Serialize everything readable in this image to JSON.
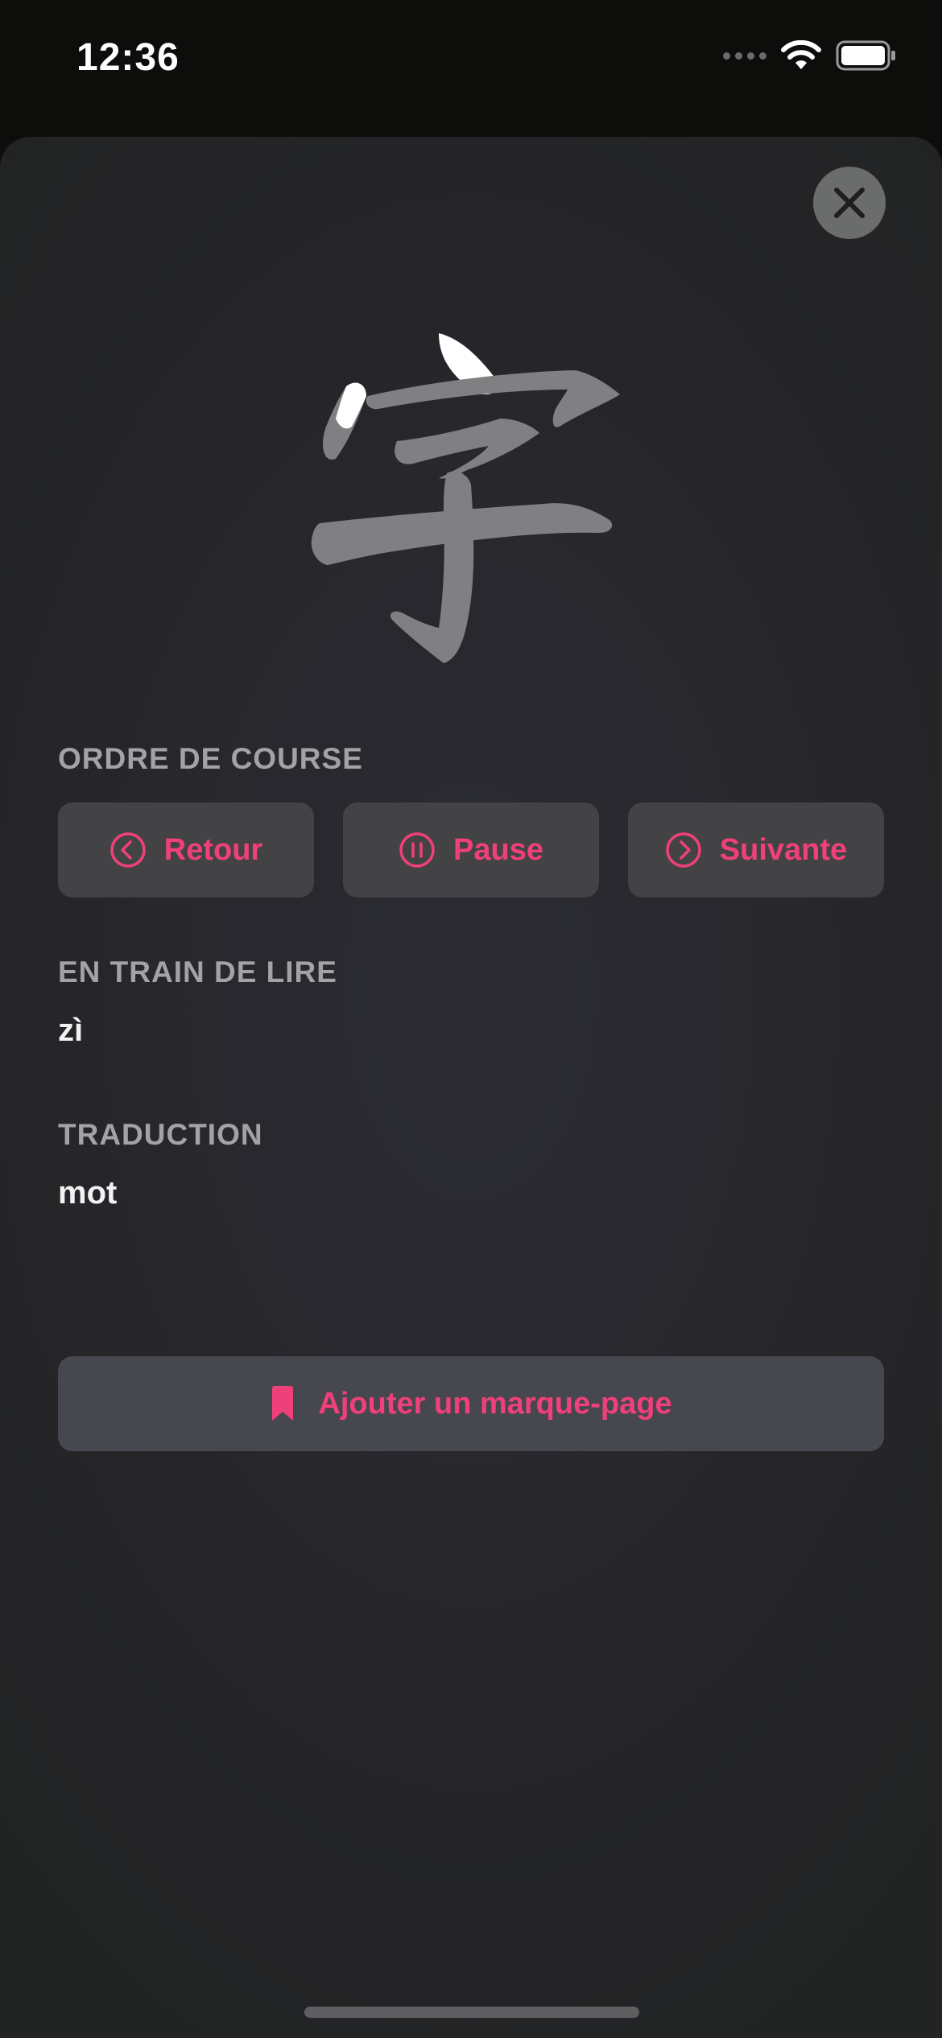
{
  "status_bar": {
    "time": "12:36",
    "icons": [
      "signal-dots-icon",
      "wifi-icon",
      "battery-icon"
    ]
  },
  "character": {
    "glyph": "字",
    "strokes_total": 6,
    "strokes_completed": 1
  },
  "stroke_order": {
    "label": "ORDRE DE COURSE",
    "buttons": [
      {
        "label": "Retour",
        "icon": "chevron-left-circle-icon"
      },
      {
        "label": "Pause",
        "icon": "pause-circle-icon"
      },
      {
        "label": "Suivante",
        "icon": "chevron-right-circle-icon"
      }
    ]
  },
  "reading": {
    "label": "EN TRAIN DE LIRE",
    "value": "zì"
  },
  "translation": {
    "label": "TRADUCTION",
    "value": "mot"
  },
  "bookmark": {
    "label": "Ajouter un marque-page",
    "icon": "bookmark-icon"
  },
  "colors": {
    "accent": "#f0407a",
    "stroke_pending": "#808083",
    "stroke_done": "#ffffff",
    "button_bg": "#434346"
  }
}
